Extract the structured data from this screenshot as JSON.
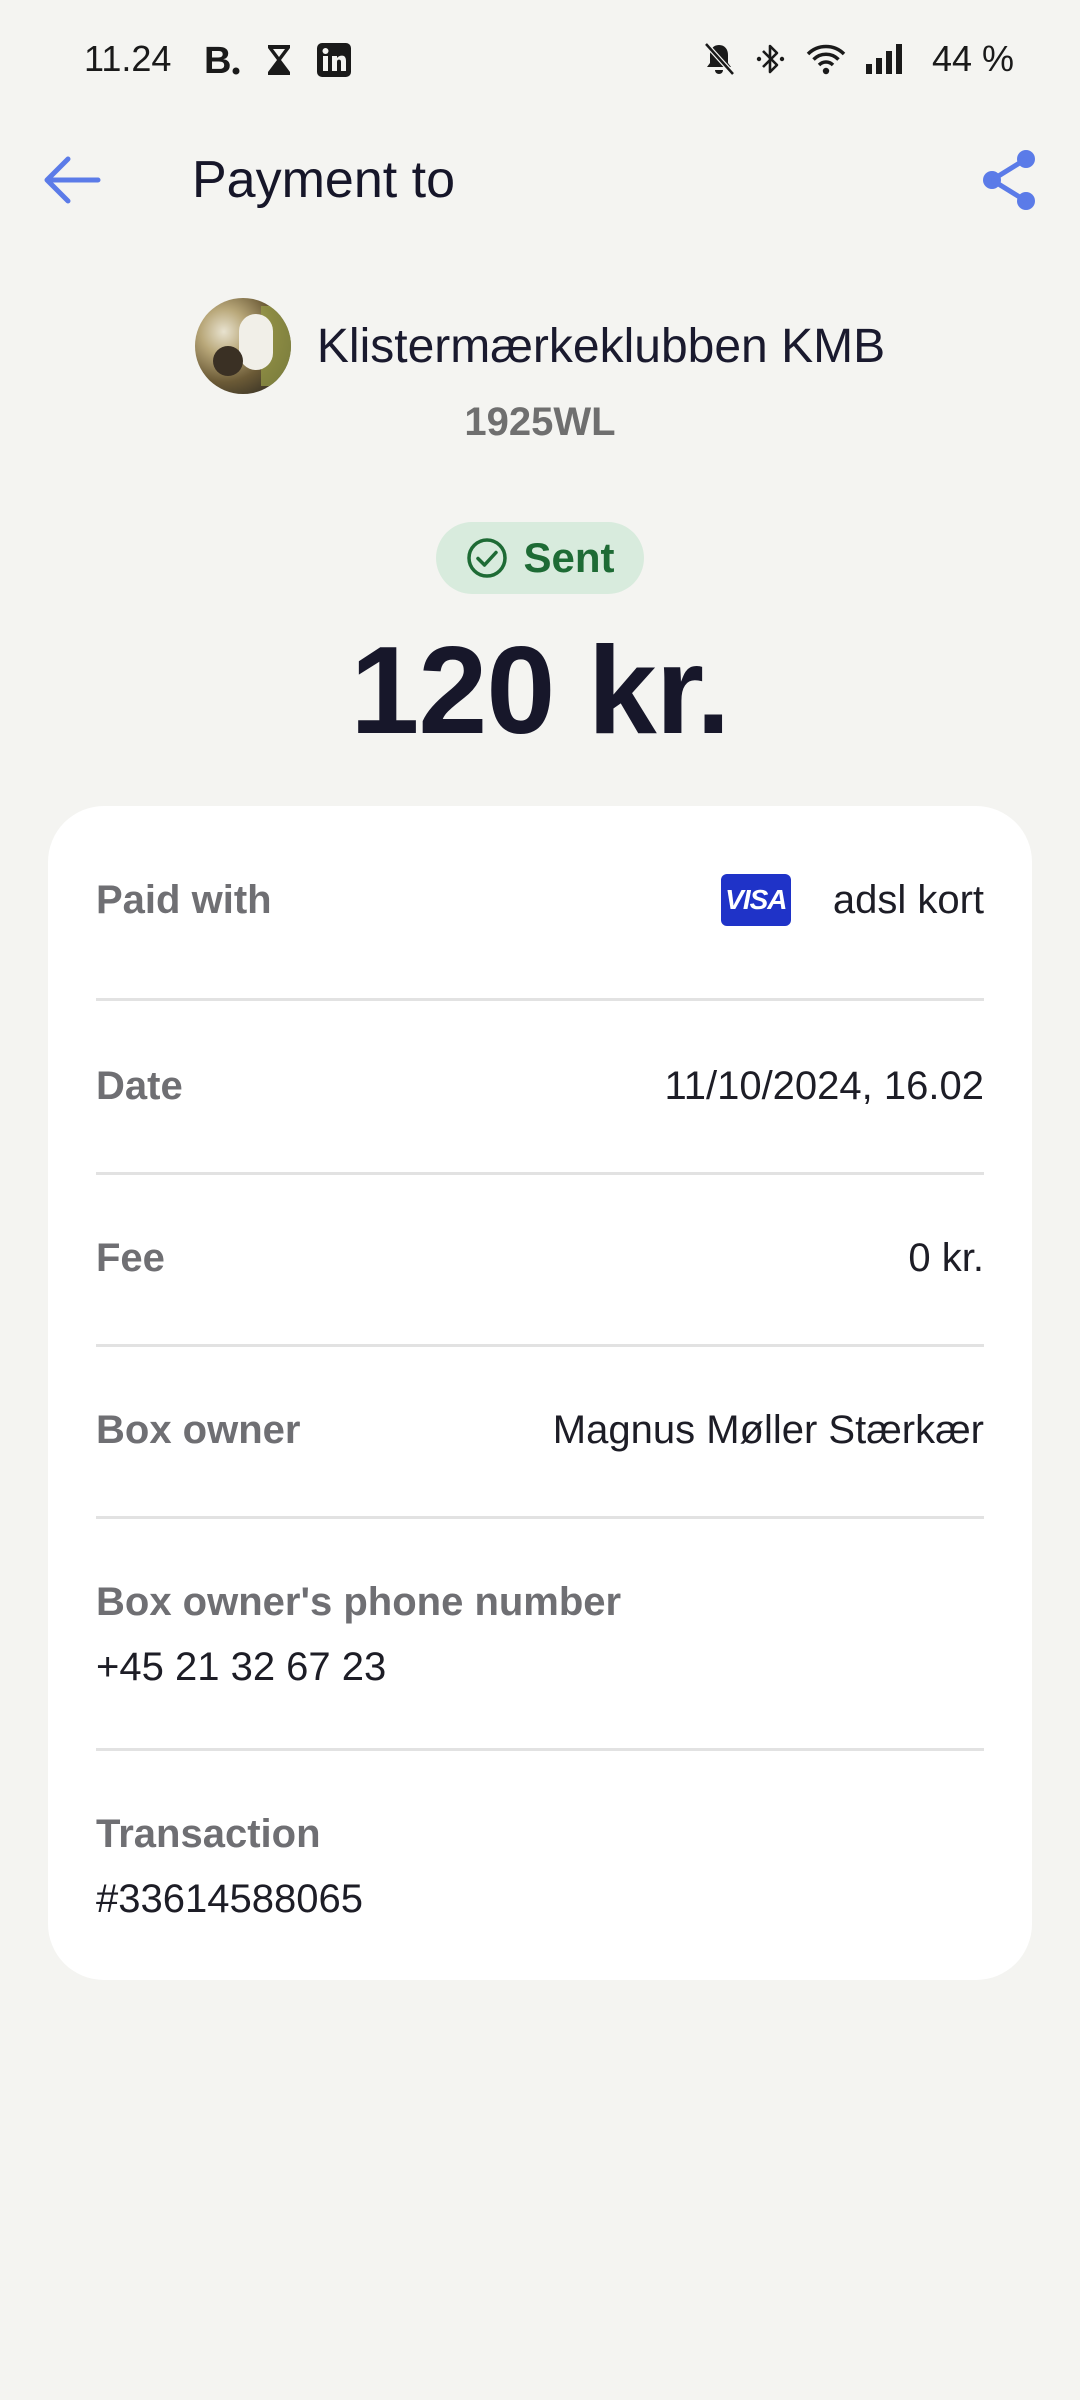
{
  "status_bar": {
    "time": "11.24",
    "battery": "44 %",
    "left_icons": [
      "booking-b-icon",
      "hourglass-icon",
      "linkedin-icon"
    ],
    "right_icons": [
      "bell-off-icon",
      "bluetooth-icon",
      "wifi-icon",
      "signal-icon"
    ]
  },
  "header": {
    "title": "Payment to",
    "back_icon": "arrow-left-icon",
    "share_icon": "share-icon"
  },
  "merchant": {
    "name": "Klistermærkeklubben KMB",
    "code": "1925WL"
  },
  "status": {
    "label": "Sent",
    "icon": "check-circle-icon"
  },
  "amount": "120 kr.",
  "details": {
    "paid_with": {
      "label": "Paid with",
      "card_brand": "VISA",
      "value": "adsl kort"
    },
    "date": {
      "label": "Date",
      "value": "11/10/2024, 16.02"
    },
    "fee": {
      "label": "Fee",
      "value": "0 kr."
    },
    "box_owner": {
      "label": "Box owner",
      "value": "Magnus Møller Stærkær"
    },
    "phone": {
      "label": "Box owner's phone number",
      "value": "+45 21 32 67 23"
    },
    "transaction": {
      "label": "Transaction",
      "value": "#33614588065"
    }
  },
  "colors": {
    "accent": "#5b7be8",
    "background": "#f4f4f1",
    "status_badge_bg": "#d8ebdd",
    "status_green": "#1e6b35",
    "visa_blue": "#1f33c8"
  }
}
